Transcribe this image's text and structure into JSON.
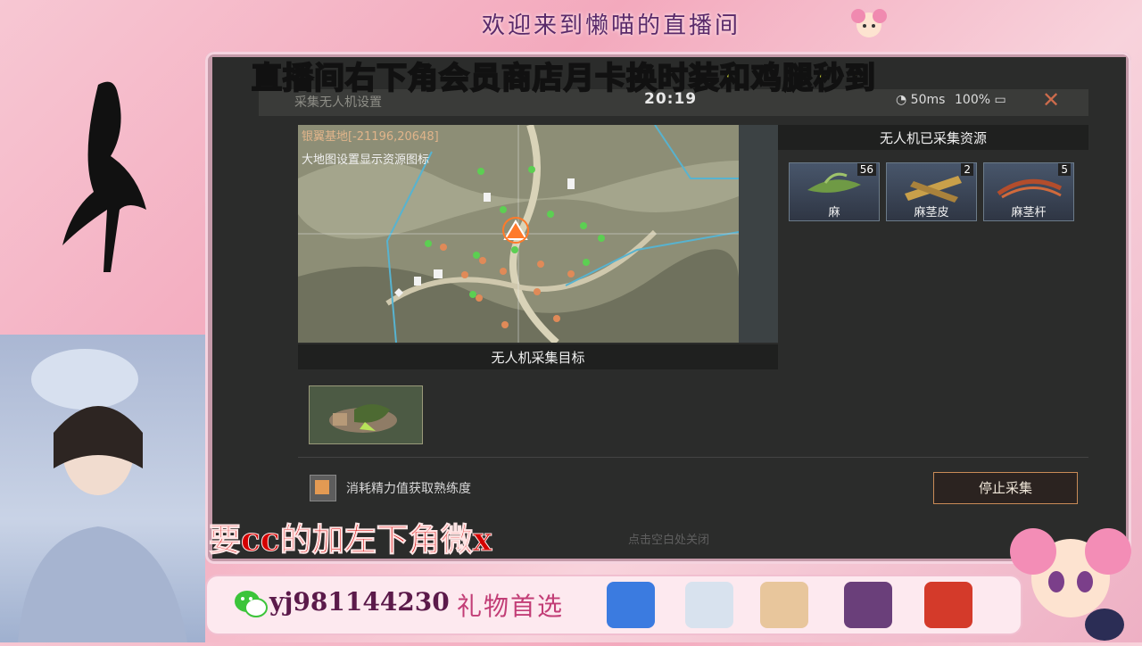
{
  "overlay": {
    "welcome": "欢迎来到懒喵的直播间",
    "top_banner": "直播间右下角会员商店月卡换时装和鸡腿秒到",
    "bottom_banner": "要cc的加左下角微x",
    "wechat_id": "yj981144230",
    "gift_label": "礼物首选"
  },
  "game": {
    "panel_title": "采集无人机设置",
    "status": {
      "time": "20:19",
      "ping": "50ms",
      "battery": "100%"
    },
    "map": {
      "location_label": "银翼基地[-21196,20648]",
      "hint": "大地图设置显示资源图标"
    },
    "target_section": {
      "title": "无人机采集目标"
    },
    "resources_section": {
      "title": "无人机已采集资源",
      "items": [
        {
          "label": "麻",
          "count": "56"
        },
        {
          "label": "麻茎皮",
          "count": "2"
        },
        {
          "label": "麻茎杆",
          "count": "5"
        }
      ]
    },
    "stamina_checkbox_label": "消耗精力值获取熟练度",
    "stop_button_label": "停止采集",
    "faint_hint": "点击空白处关闭"
  },
  "colors": {
    "accent": "#c98b57",
    "banner_yellow": "#f6ff3a",
    "banner_red": "#d40000"
  }
}
